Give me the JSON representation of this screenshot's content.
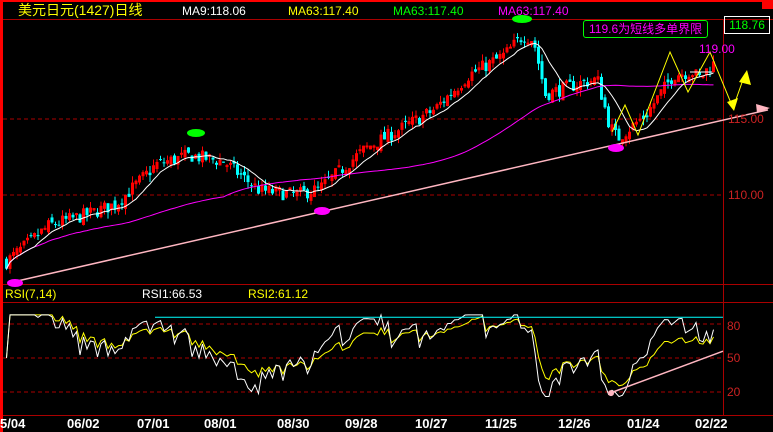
{
  "header": {
    "title": "美元日元(1427)日线",
    "ma_labels": [
      {
        "text": "MA9:118.06",
        "color": "#ffffff"
      },
      {
        "text": "MA63:117.40",
        "color": "#ffff00"
      },
      {
        "text": "MA63:117.40",
        "color": "#00ff00"
      },
      {
        "text": "MA63:117.40",
        "color": "#ff00ff"
      }
    ]
  },
  "annotations": {
    "note_box": "119.6为短线多单界限",
    "target_label": "119.00",
    "last_price": "118.76"
  },
  "rsi_header": {
    "name": "RSI(7,14)",
    "rsi1": "RSI1:66.53",
    "rsi2": "RSI2:61.12"
  },
  "chart_data": [
    {
      "type": "candlestick",
      "title": "美元日元(1427)日线",
      "y_ticks": [
        "115.00",
        "110.00"
      ],
      "y_tick_values": [
        115,
        110
      ],
      "ylim": [
        103.5,
        121.1
      ],
      "x_ticks": [
        "5/04",
        "06/02",
        "07/01",
        "08/01",
        "08/30",
        "09/28",
        "10/27",
        "11/25",
        "12/26",
        "01/24",
        "02/22"
      ],
      "close_path": [
        {
          "date": "5/04",
          "close": 105.6
        },
        {
          "date": "5/20",
          "close": 108.0
        },
        {
          "date": "06/02",
          "close": 108.7
        },
        {
          "date": "06/15",
          "close": 109.4
        },
        {
          "date": "07/01",
          "close": 112.0
        },
        {
          "date": "07/15",
          "close": 112.6
        },
        {
          "date": "08/01",
          "close": 112.2
        },
        {
          "date": "08/15",
          "close": 110.3
        },
        {
          "date": "08/30",
          "close": 110.0
        },
        {
          "date": "09/10",
          "close": 110.4
        },
        {
          "date": "09/28",
          "close": 113.0
        },
        {
          "date": "10/12",
          "close": 114.3
        },
        {
          "date": "10/27",
          "close": 115.6
        },
        {
          "date": "11/10",
          "close": 117.9
        },
        {
          "date": "11/25",
          "close": 119.2
        },
        {
          "date": "12/05",
          "close": 120.5
        },
        {
          "date": "12/10",
          "close": 120.2
        },
        {
          "date": "12/14",
          "close": 116.6
        },
        {
          "date": "12/26",
          "close": 117.3
        },
        {
          "date": "01/05",
          "close": 117.6
        },
        {
          "date": "01/12",
          "close": 114.6
        },
        {
          "date": "01/17",
          "close": 113.7
        },
        {
          "date": "01/24",
          "close": 115.3
        },
        {
          "date": "02/05",
          "close": 117.9
        },
        {
          "date": "02/12",
          "close": 118.1
        },
        {
          "date": "02/16",
          "close": 117.7
        },
        {
          "date": "02/22",
          "close": 118.76
        }
      ],
      "series": [
        {
          "name": "MA9",
          "value": 118.06,
          "color": "#ffffff"
        },
        {
          "name": "MA63",
          "value": 117.4,
          "color": "#ff00ff"
        }
      ],
      "up_color": "#ff0000",
      "down_color": "#00ffff",
      "support_line": {
        "from": {
          "date": "5/04",
          "value": 104.2
        },
        "to": {
          "date": "02/22",
          "value": 115.1
        },
        "color": "#ffb6c1"
      },
      "projection": {
        "points": [
          117.0,
          119.0,
          115.6,
          118.4
        ],
        "color": "#ffff00"
      },
      "grid": "dashed at ticks"
    },
    {
      "type": "line",
      "title": "RSI(7,14)",
      "y_ticks": [
        "80",
        "50",
        "20"
      ],
      "y_tick_values": [
        80,
        50,
        20
      ],
      "series": [
        {
          "name": "RSI1",
          "last": 66.53,
          "color": "#ffffff"
        },
        {
          "name": "RSI2",
          "last": 61.12,
          "color": "#ffff00"
        }
      ],
      "resistance_level": 86,
      "resistance_color": "#00ffff",
      "support_line": {
        "from": {
          "date": "01/12",
          "value": 19
        },
        "to": {
          "date": "02/22",
          "value": 56
        },
        "color": "#ffb6c1"
      }
    }
  ]
}
